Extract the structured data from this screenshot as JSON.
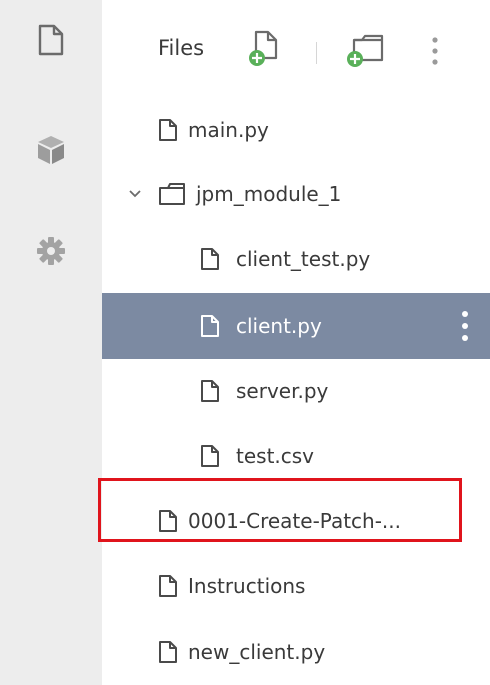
{
  "activity_bar": {
    "items": [
      {
        "icon": "file-icon"
      },
      {
        "icon": "package-cube-icon"
      },
      {
        "icon": "gear-icon"
      }
    ]
  },
  "explorer": {
    "title": "Files",
    "actions": [
      {
        "icon": "new-file-icon"
      },
      {
        "icon": "new-folder-icon"
      },
      {
        "icon": "more-vertical-icon"
      }
    ],
    "tree": [
      {
        "label": "main.py",
        "type": "file",
        "depth": 0
      },
      {
        "label": "jpm_module_1",
        "type": "folder",
        "depth": 0,
        "expanded": true
      },
      {
        "label": "client_test.py",
        "type": "file",
        "depth": 1
      },
      {
        "label": "client.py",
        "type": "file",
        "depth": 1,
        "selected": true
      },
      {
        "label": "server.py",
        "type": "file",
        "depth": 1
      },
      {
        "label": "test.csv",
        "type": "file",
        "depth": 1
      },
      {
        "label": "0001-Create-Patch-...",
        "type": "file",
        "depth": 0,
        "highlighted": true
      },
      {
        "label": "Instructions",
        "type": "file",
        "depth": 0
      },
      {
        "label": "new_client.py",
        "type": "file",
        "depth": 0
      }
    ]
  },
  "colors": {
    "activity_bar_bg": "#ededed",
    "selected_row_bg": "#7c8aa2",
    "new_item_badge": "#5ab05a",
    "highlight_border": "#e0141c"
  }
}
